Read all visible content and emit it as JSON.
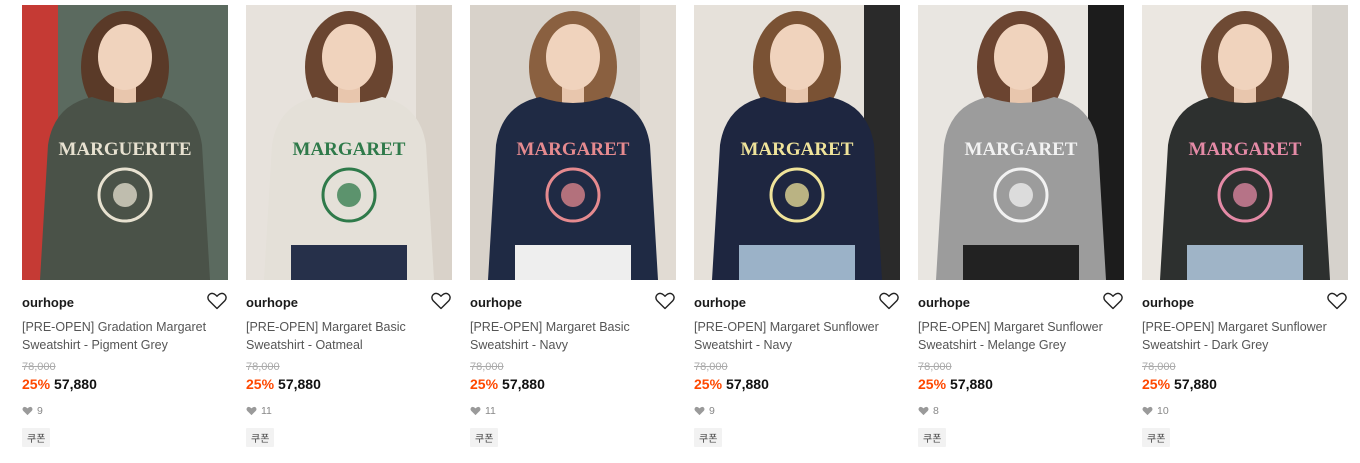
{
  "products": [
    {
      "brand": "ourhope",
      "title": "[PRE-OPEN] Gradation Margaret Sweatshirt - Pigment Grey",
      "original_price": "78,000",
      "discount": "25%",
      "price": "57,880",
      "likes": "9",
      "badge": "쿠폰",
      "print_text": "MARGUERITE"
    },
    {
      "brand": "ourhope",
      "title": "[PRE-OPEN] Margaret Basic Sweatshirt - Oatmeal",
      "original_price": "78,000",
      "discount": "25%",
      "price": "57,880",
      "likes": "11",
      "badge": "쿠폰",
      "print_text": "MARGARET"
    },
    {
      "brand": "ourhope",
      "title": "[PRE-OPEN] Margaret Basic Sweatshirt - Navy",
      "original_price": "78,000",
      "discount": "25%",
      "price": "57,880",
      "likes": "11",
      "badge": "쿠폰",
      "print_text": "MARGARET"
    },
    {
      "brand": "ourhope",
      "title": "[PRE-OPEN] Margaret Sunflower Sweatshirt - Navy",
      "original_price": "78,000",
      "discount": "25%",
      "price": "57,880",
      "likes": "9",
      "badge": "쿠폰",
      "print_text": "MARGARET"
    },
    {
      "brand": "ourhope",
      "title": "[PRE-OPEN] Margaret Sunflower Sweatshirt - Melange Grey",
      "original_price": "78,000",
      "discount": "25%",
      "price": "57,880",
      "likes": "8",
      "badge": "쿠폰",
      "print_text": "MARGARET"
    },
    {
      "brand": "ourhope",
      "title": "[PRE-OPEN] Margaret Sunflower Sweatshirt - Dark Grey",
      "original_price": "78,000",
      "discount": "25%",
      "price": "57,880",
      "likes": "10",
      "badge": "쿠폰",
      "print_text": "MARGARET"
    }
  ],
  "colors": {
    "discount": "#ff4800",
    "text": "#111111",
    "muted": "#888888"
  },
  "icons": {
    "wishlist": "heart-outline-icon",
    "likes": "heart-filled-icon"
  }
}
